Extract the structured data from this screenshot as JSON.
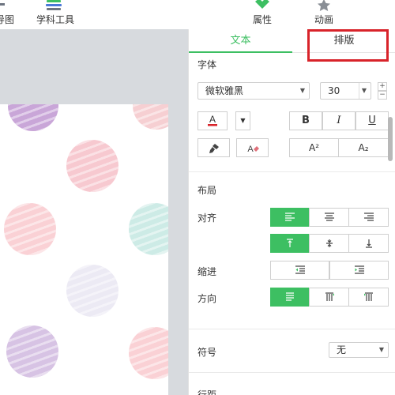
{
  "toolbar": {
    "mindmap_label": "导图",
    "subject_tools_label": "学科工具",
    "properties_label": "属性",
    "animation_label": "动画"
  },
  "panel": {
    "tabs": {
      "text": "文本",
      "layout": "排版"
    },
    "font": {
      "section_title": "字体",
      "family_value": "微软雅黑",
      "size_value": "30",
      "bold_label": "B",
      "italic_label": "I",
      "underline_label": "U",
      "superscript_label": "A²",
      "subscript_label": "A₂",
      "font_color": "#d8232a"
    },
    "layout": {
      "section_title": "布局",
      "align_label": "对齐",
      "indent_label": "缩进",
      "direction_label": "方向"
    },
    "symbol": {
      "label": "符号",
      "value": "无"
    },
    "spacing": {
      "label": "行距"
    }
  },
  "colors": {
    "accent": "#3dbf62",
    "highlight": "#d8232a"
  }
}
